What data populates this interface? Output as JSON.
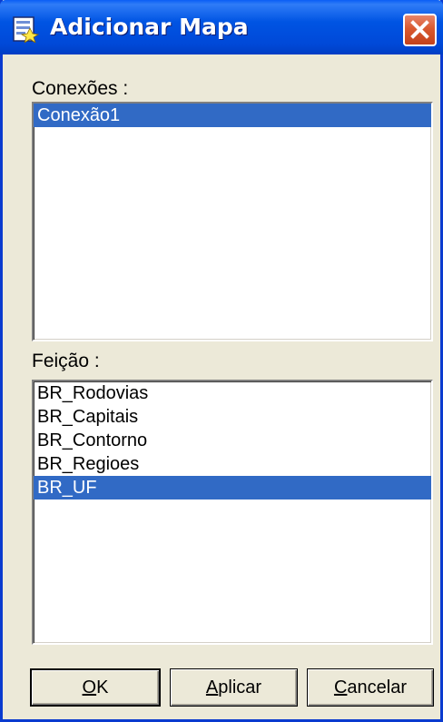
{
  "window": {
    "title": "Adicionar Mapa",
    "title_bar_color": "#0054e3",
    "close_button_color": "#d9592f",
    "icon": "add-map-icon"
  },
  "connections": {
    "label": "Conexões :",
    "items": [
      "Conexão1"
    ],
    "selected_index": 0
  },
  "features": {
    "label": "Feição :",
    "items": [
      "BR_Rodovias",
      "BR_Capitais",
      "BR_Contorno",
      "BR_Regioes",
      "BR_UF"
    ],
    "selected_index": 4
  },
  "buttons": {
    "ok": {
      "mnemonic": "O",
      "rest": "K"
    },
    "apply": {
      "mnemonic": "A",
      "rest": "plicar"
    },
    "cancel": {
      "mnemonic": "C",
      "rest": "ancelar"
    }
  },
  "selection_color": "#316ac5"
}
